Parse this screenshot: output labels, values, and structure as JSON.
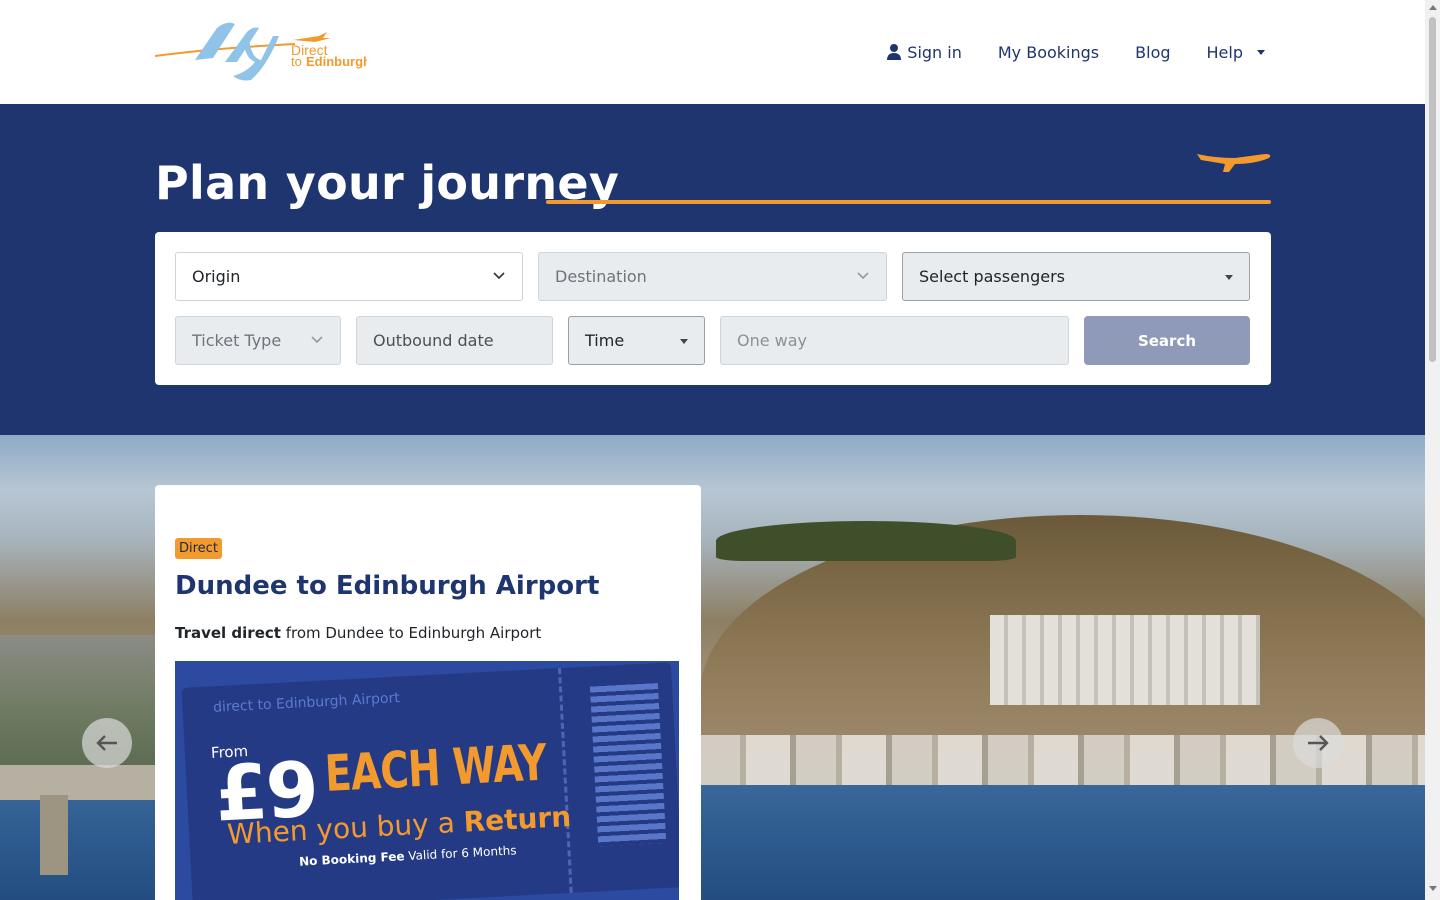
{
  "header": {
    "logo": {
      "text_top": "Direct",
      "text_bottom_1": "to",
      "text_bottom_2": "Edinburgh"
    },
    "nav": {
      "sign_in": "Sign in",
      "bookings": "My Bookings",
      "blog": "Blog",
      "help": "Help"
    }
  },
  "hero": {
    "title": "Plan your journey",
    "search": {
      "origin": "Origin",
      "destination": "Destination",
      "passengers": "Select passengers",
      "ticket_type": "Ticket Type",
      "outbound_date": "Outbound date",
      "time": "Time",
      "one_way": "One way",
      "search_button": "Search"
    }
  },
  "route": {
    "badge": "Direct",
    "title": "Dundee to Edinburgh Airport",
    "desc_bold": "Travel direct",
    "desc_rest": " from Dundee to Edinburgh Airport",
    "promo": {
      "brand": "direct to Edinburgh Airport",
      "from": "From",
      "price": "£9",
      "each_way": "EACH WAY",
      "when_pre": "When you buy a ",
      "when_bold": "Return",
      "fee_bold": "No Booking Fee",
      "fee_rest": " Valid for 6 Months"
    }
  },
  "colors": {
    "navy": "#1f3570",
    "orange": "#f29a2e",
    "sky": "#8fc3e8",
    "search_button": "#8f9ab8"
  }
}
